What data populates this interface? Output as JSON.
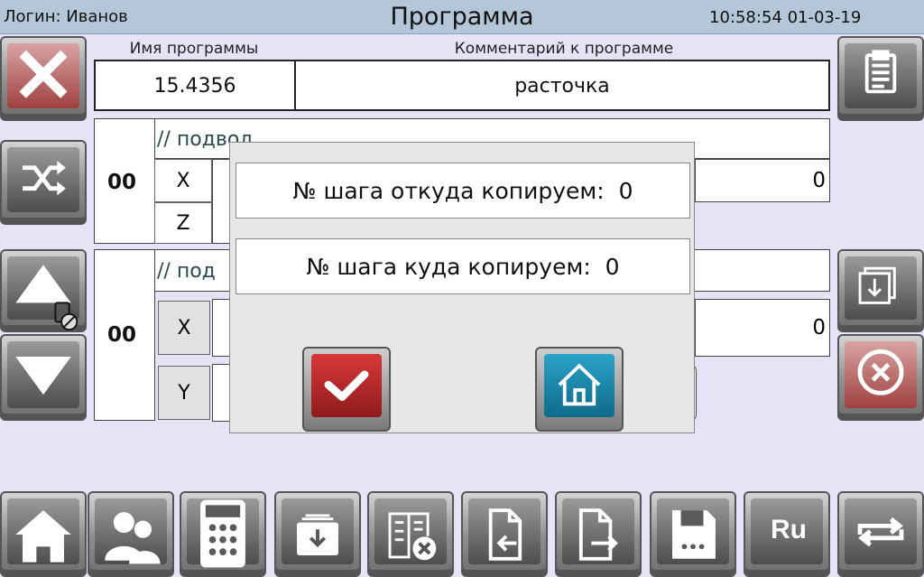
{
  "header": {
    "login": "Логин: Иванов",
    "title": "Программа",
    "datetime": "10:58:54 01-03-19"
  },
  "program": {
    "name_label": "Имя программы",
    "comment_label": "Комментарий к программе",
    "name_value": "15.4356",
    "comment_value": "расточка"
  },
  "steps": [
    {
      "number": "00",
      "comment": "// подвод",
      "axes": [
        "X",
        "Z"
      ],
      "value": "0"
    },
    {
      "number": "00",
      "comment": "//  под",
      "axes": [
        "X",
        "Y"
      ],
      "value": "0"
    }
  ],
  "dialog": {
    "from_label": "№ шага откуда копируем:",
    "from_value": "0",
    "to_label": "№ шага куда копируем:",
    "to_value": "0",
    "confirm_icon": "checkmark-icon",
    "cancel_icon": "home-icon"
  },
  "side_buttons_left": [
    "close-icon",
    "shuffle-icon",
    "arrow-up-icon",
    "arrow-down-icon"
  ],
  "side_buttons_right": [
    "clipboard-icon",
    "copy-down-icon",
    "cancel-circle-icon"
  ],
  "toolbar": {
    "icons": [
      "home-icon",
      "users-icon",
      "calculator-icon",
      "inbox-download-icon",
      "book-delete-icon",
      "file-import-icon",
      "file-export-icon",
      "floppy-disk-icon",
      "language-icon",
      "repeat-icon"
    ],
    "language_label": "Ru"
  },
  "colors": {
    "background": "#e4e4f6",
    "header": "#b3c7d9",
    "confirm": "#c0282a",
    "home": "#1a8ab0"
  }
}
